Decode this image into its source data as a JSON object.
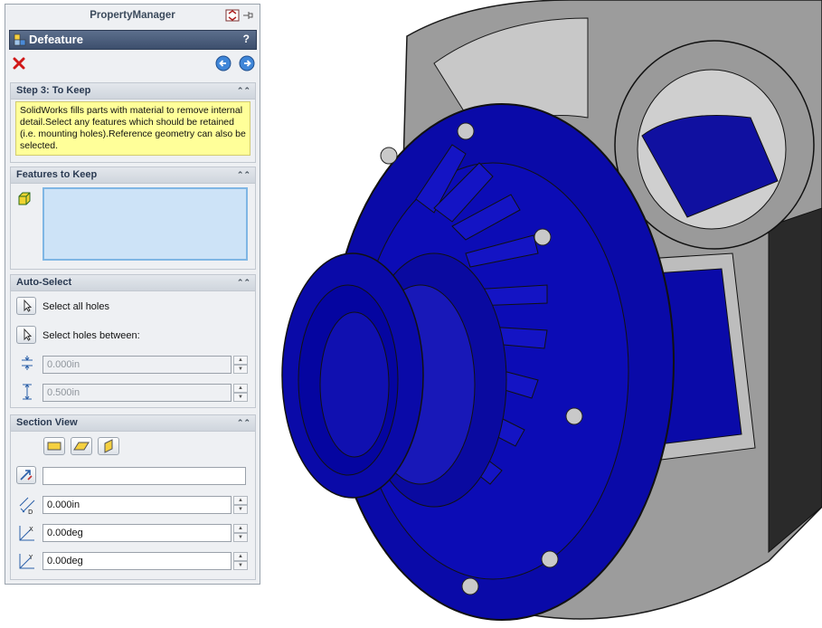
{
  "panel": {
    "title": "PropertyManager",
    "feature_name": "Defeature",
    "help_label": "?"
  },
  "step3": {
    "header": "Step 3: To Keep",
    "message": "SolidWorks fills parts with material to remove internal detail.Select any features which should be retained (i.e. mounting holes).Reference geometry can also be selected."
  },
  "keep": {
    "header": "Features to Keep"
  },
  "auto_select": {
    "header": "Auto-Select",
    "all_holes_label": "Select all holes",
    "between_label": "Select holes between:",
    "min_value": "0.000in",
    "max_value": "0.500in"
  },
  "section_view": {
    "header": "Section View",
    "reference_value": "",
    "offset_value": "0.000in",
    "x_rotation": "0.00deg",
    "y_rotation": "0.00deg"
  },
  "colors": {
    "model_blue": "#0a0aa8",
    "model_gray": "#8a8a8a",
    "header_blue": "#4a5c7a",
    "message_yellow": "#ffff99"
  }
}
